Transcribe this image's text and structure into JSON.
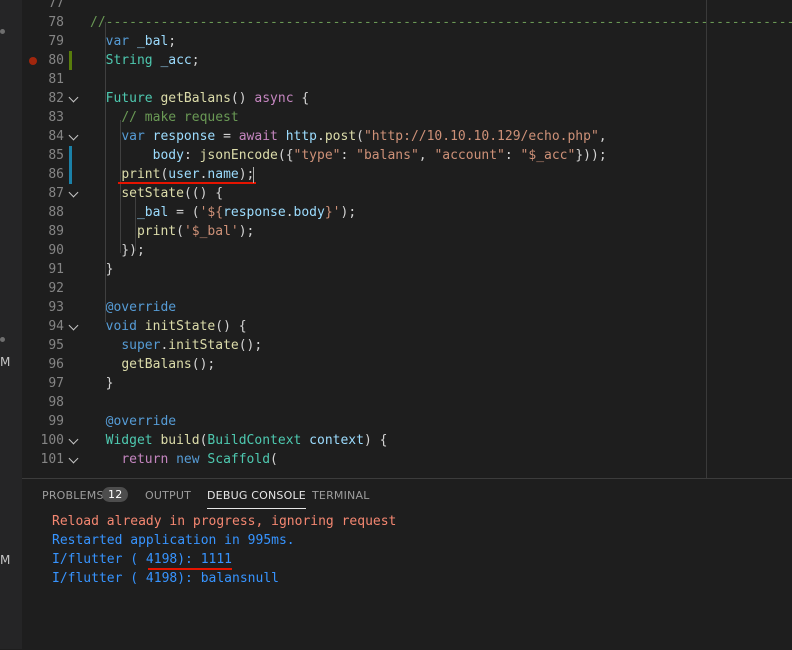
{
  "editor": {
    "lines": [
      {
        "num": "77",
        "tokens": []
      },
      {
        "num": "78",
        "tokens": [
          {
            "cls": "cm",
            "text": "//-------------------------------------------------------------------------------------------"
          }
        ]
      },
      {
        "num": "79",
        "tokens": [
          {
            "cls": "p",
            "text": "  "
          },
          {
            "cls": "k",
            "text": "var"
          },
          {
            "cls": "v",
            "text": " _bal"
          },
          {
            "cls": "p",
            "text": ";"
          }
        ]
      },
      {
        "num": "80",
        "tokens": [
          {
            "cls": "p",
            "text": "  "
          },
          {
            "cls": "t",
            "text": "String"
          },
          {
            "cls": "v",
            "text": " _acc"
          },
          {
            "cls": "p",
            "text": ";"
          }
        ]
      },
      {
        "num": "81",
        "tokens": []
      },
      {
        "num": "82",
        "tokens": [
          {
            "cls": "p",
            "text": "  "
          },
          {
            "cls": "t",
            "text": "Future"
          },
          {
            "cls": "p",
            "text": " "
          },
          {
            "cls": "f",
            "text": "getBalans"
          },
          {
            "cls": "p",
            "text": "() "
          },
          {
            "cls": "c",
            "text": "async"
          },
          {
            "cls": "p",
            "text": " {"
          }
        ]
      },
      {
        "num": "83",
        "tokens": [
          {
            "cls": "p",
            "text": "    "
          },
          {
            "cls": "cm",
            "text": "// make request"
          }
        ]
      },
      {
        "num": "84",
        "tokens": [
          {
            "cls": "p",
            "text": "    "
          },
          {
            "cls": "k",
            "text": "var"
          },
          {
            "cls": "v",
            "text": " response"
          },
          {
            "cls": "p",
            "text": " = "
          },
          {
            "cls": "c",
            "text": "await"
          },
          {
            "cls": "v",
            "text": " http"
          },
          {
            "cls": "p",
            "text": "."
          },
          {
            "cls": "f",
            "text": "post"
          },
          {
            "cls": "p",
            "text": "("
          },
          {
            "cls": "s",
            "text": "\"http://10.10.10.129/echo.php\""
          },
          {
            "cls": "p",
            "text": ","
          }
        ]
      },
      {
        "num": "85",
        "tokens": [
          {
            "cls": "p",
            "text": "        "
          },
          {
            "cls": "v",
            "text": "body"
          },
          {
            "cls": "p",
            "text": ": "
          },
          {
            "cls": "f",
            "text": "jsonEncode"
          },
          {
            "cls": "p",
            "text": "({"
          },
          {
            "cls": "s",
            "text": "\"type\""
          },
          {
            "cls": "p",
            "text": ": "
          },
          {
            "cls": "s",
            "text": "\"balans\""
          },
          {
            "cls": "p",
            "text": ", "
          },
          {
            "cls": "s",
            "text": "\"account\""
          },
          {
            "cls": "p",
            "text": ": "
          },
          {
            "cls": "s",
            "text": "\"$_acc\""
          },
          {
            "cls": "p",
            "text": "}));"
          }
        ]
      },
      {
        "num": "86",
        "tokens": [
          {
            "cls": "p",
            "text": "    "
          },
          {
            "cls": "f",
            "text": "print"
          },
          {
            "cls": "p",
            "text": "("
          },
          {
            "cls": "v",
            "text": "user"
          },
          {
            "cls": "p",
            "text": "."
          },
          {
            "cls": "v",
            "text": "name"
          },
          {
            "cls": "p",
            "text": ");"
          }
        ]
      },
      {
        "num": "87",
        "tokens": [
          {
            "cls": "p",
            "text": "    "
          },
          {
            "cls": "f",
            "text": "setState"
          },
          {
            "cls": "p",
            "text": "(() {"
          }
        ]
      },
      {
        "num": "88",
        "tokens": [
          {
            "cls": "p",
            "text": "      "
          },
          {
            "cls": "v",
            "text": "_bal"
          },
          {
            "cls": "p",
            "text": " = ("
          },
          {
            "cls": "s",
            "text": "'${"
          },
          {
            "cls": "v",
            "text": "response"
          },
          {
            "cls": "p",
            "text": "."
          },
          {
            "cls": "v",
            "text": "body"
          },
          {
            "cls": "s",
            "text": "}'"
          },
          {
            "cls": "p",
            "text": ");"
          }
        ]
      },
      {
        "num": "89",
        "tokens": [
          {
            "cls": "p",
            "text": "      "
          },
          {
            "cls": "f",
            "text": "print"
          },
          {
            "cls": "p",
            "text": "("
          },
          {
            "cls": "s",
            "text": "'$_bal'"
          },
          {
            "cls": "p",
            "text": ");"
          }
        ]
      },
      {
        "num": "90",
        "tokens": [
          {
            "cls": "p",
            "text": "    });"
          }
        ]
      },
      {
        "num": "91",
        "tokens": [
          {
            "cls": "p",
            "text": "  }"
          }
        ]
      },
      {
        "num": "92",
        "tokens": []
      },
      {
        "num": "93",
        "tokens": [
          {
            "cls": "p",
            "text": "  "
          },
          {
            "cls": "k",
            "text": "@override"
          }
        ]
      },
      {
        "num": "94",
        "tokens": [
          {
            "cls": "p",
            "text": "  "
          },
          {
            "cls": "k",
            "text": "void"
          },
          {
            "cls": "p",
            "text": " "
          },
          {
            "cls": "f",
            "text": "initState"
          },
          {
            "cls": "p",
            "text": "() {"
          }
        ]
      },
      {
        "num": "95",
        "tokens": [
          {
            "cls": "p",
            "text": "    "
          },
          {
            "cls": "k",
            "text": "super"
          },
          {
            "cls": "p",
            "text": "."
          },
          {
            "cls": "f",
            "text": "initState"
          },
          {
            "cls": "p",
            "text": "();"
          }
        ]
      },
      {
        "num": "96",
        "tokens": [
          {
            "cls": "p",
            "text": "    "
          },
          {
            "cls": "f",
            "text": "getBalans"
          },
          {
            "cls": "p",
            "text": "();"
          }
        ]
      },
      {
        "num": "97",
        "tokens": [
          {
            "cls": "p",
            "text": "  }"
          }
        ]
      },
      {
        "num": "98",
        "tokens": []
      },
      {
        "num": "99",
        "tokens": [
          {
            "cls": "p",
            "text": "  "
          },
          {
            "cls": "k",
            "text": "@override"
          }
        ]
      },
      {
        "num": "100",
        "tokens": [
          {
            "cls": "p",
            "text": "  "
          },
          {
            "cls": "t",
            "text": "Widget"
          },
          {
            "cls": "p",
            "text": " "
          },
          {
            "cls": "f",
            "text": "build"
          },
          {
            "cls": "p",
            "text": "("
          },
          {
            "cls": "t",
            "text": "BuildContext"
          },
          {
            "cls": "v",
            "text": " context"
          },
          {
            "cls": "p",
            "text": ") {"
          }
        ]
      },
      {
        "num": "101",
        "tokens": [
          {
            "cls": "p",
            "text": "    "
          },
          {
            "cls": "c",
            "text": "return"
          },
          {
            "cls": "p",
            "text": " "
          },
          {
            "cls": "k",
            "text": "new"
          },
          {
            "cls": "p",
            "text": " "
          },
          {
            "cls": "t",
            "text": "Scaffold"
          },
          {
            "cls": "p",
            "text": "("
          }
        ]
      }
    ]
  },
  "panel": {
    "tabs": [
      {
        "label": "PROBLEMS",
        "badge": "12",
        "active": false
      },
      {
        "label": "OUTPUT",
        "active": false
      },
      {
        "label": "DEBUG CONSOLE",
        "active": true
      },
      {
        "label": "TERMINAL",
        "active": false
      }
    ],
    "console": [
      {
        "cls": "err",
        "text": "Reload already in progress, ignoring request"
      },
      {
        "cls": "info",
        "text": "Restarted application in 995ms."
      },
      {
        "cls": "out",
        "text": "I/flutter ( 4198): 1111"
      },
      {
        "cls": "out",
        "text": "I/flutter ( 4198): balansnull"
      }
    ]
  },
  "leftstrip": {
    "marker1": "M",
    "marker2": "M"
  },
  "colors": {
    "background": "#1e1e1e",
    "keyword": "#569cd6",
    "string": "#ce9178",
    "comment": "#6a9955",
    "error": "#f48771",
    "info": "#3794ff",
    "underline": "#e51400"
  }
}
